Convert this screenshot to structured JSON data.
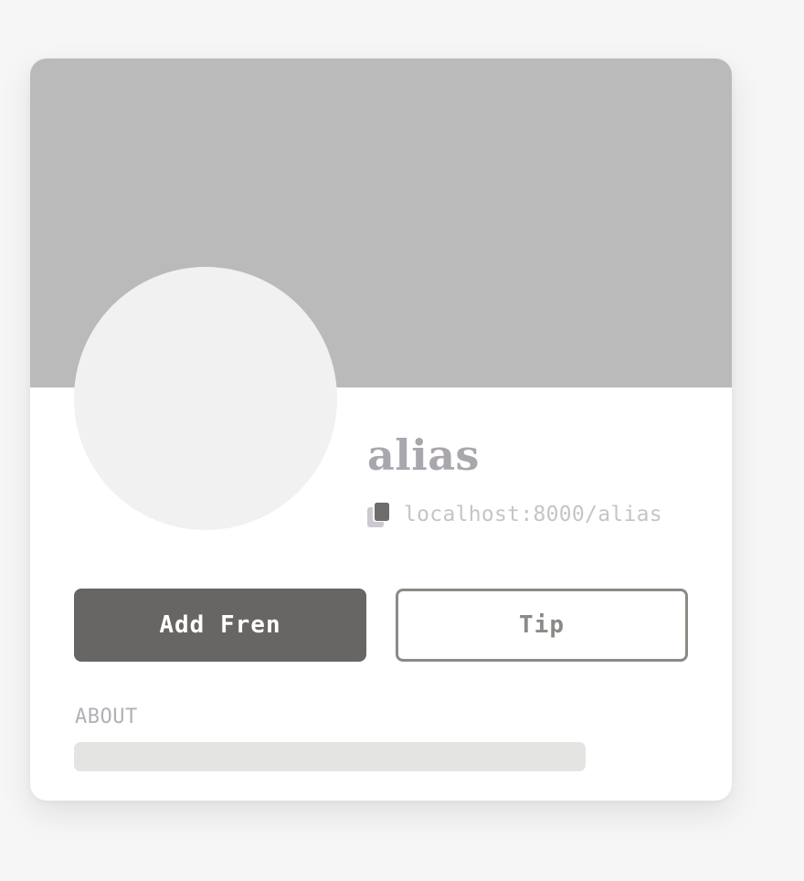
{
  "profile": {
    "name": "alias",
    "link": "localhost:8000/alias",
    "copy_icon": "copy-icon"
  },
  "actions": {
    "add_label": "Add Fren",
    "tip_label": "Tip"
  },
  "about": {
    "label": "ABOUT"
  },
  "colors": {
    "page_bg": "#f5f6f5",
    "banner": "#bababa",
    "avatar": "#f1f1f1",
    "primary_button": "#686664",
    "secondary_border": "#8c8a85",
    "name_text": "#aaa6ad",
    "link_text": "#c6c3c9",
    "about_placeholder": "#e4e5e2"
  }
}
